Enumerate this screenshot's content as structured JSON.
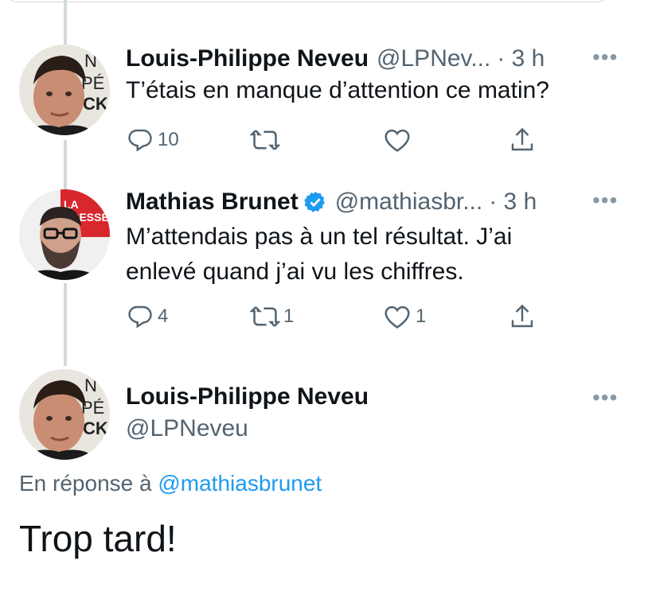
{
  "tweets": [
    {
      "name": "Louis-Philippe Neveu",
      "handle": "@LPNev...",
      "time": "· 3 h",
      "text": "T’étais en manque d’attention ce matin?",
      "stats": {
        "replies": "10",
        "retweets": "",
        "likes": ""
      },
      "avatar": {
        "icon": "person-photo-avatar",
        "bg_letters": [
          "N",
          "PÉI",
          "CK"
        ]
      }
    },
    {
      "name": "Mathias Brunet",
      "handle": "@mathiasbr...",
      "time": "· 3 h",
      "verified": true,
      "text_lines": [
        "M’attendais pas à un tel résultat. J’ai",
        "enlevé quand j’ai vu les chiffres."
      ],
      "stats": {
        "replies": "4",
        "retweets": "1",
        "likes": "1"
      },
      "avatar": {
        "icon": "person-photo-avatar",
        "badge_lines": [
          "LA",
          "PRESSE"
        ],
        "badge_color": "#d9272e"
      }
    }
  ],
  "focused_tweet": {
    "name": "Louis-Philippe Neveu",
    "handle": "@LPNeveu",
    "reply_prefix": "En réponse à",
    "reply_mention": "@mathiasbrunet",
    "text": "Trop tard!",
    "avatar": {
      "icon": "person-photo-avatar",
      "bg_letters": [
        "N",
        "PÉI",
        "CK"
      ]
    }
  },
  "more_label": "•••",
  "colors": {
    "accent": "#1d9bf0",
    "secondary_text": "#536471",
    "thread_line": "#cfd9de"
  }
}
